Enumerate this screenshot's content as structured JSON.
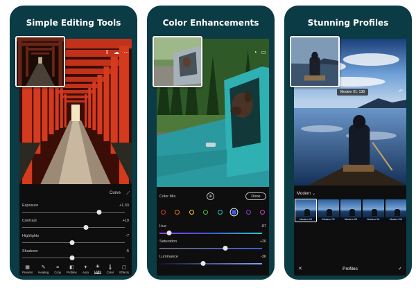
{
  "panels": [
    {
      "title": "Simple Editing Tools",
      "curve_label": "Curve",
      "sliders": [
        {
          "label": "Exposure",
          "value": "+1.33",
          "position": 0.72
        },
        {
          "label": "Contrast",
          "value": "+19",
          "position": 0.6
        },
        {
          "label": "Highlights",
          "value": "-7",
          "position": 0.47
        },
        {
          "label": "Shadows",
          "value": "-5",
          "position": 0.47
        }
      ],
      "toolbar": [
        {
          "label": "Presets",
          "icon": "presets-icon",
          "glyph": "▦"
        },
        {
          "label": "Healing",
          "icon": "healing-icon",
          "glyph": "✎"
        },
        {
          "label": "Crop",
          "icon": "crop-icon",
          "glyph": "⌗"
        },
        {
          "label": "Profiles",
          "icon": "profiles-icon",
          "glyph": "◧"
        },
        {
          "label": "Auto",
          "icon": "auto-icon",
          "glyph": "✦"
        },
        {
          "label": "Light",
          "icon": "light-icon",
          "glyph": "☀"
        },
        {
          "label": "Color",
          "icon": "color-icon",
          "glyph": "🌡"
        },
        {
          "label": "Effects",
          "icon": "effects-icon",
          "glyph": "▢"
        }
      ],
      "active_tool": "Light"
    },
    {
      "title": "Color Enhancements",
      "color_mix_label": "Color Mix",
      "done_label": "Done",
      "swatch_colors": [
        "#e0352b",
        "#f07a1e",
        "#f2d21a",
        "#48c23c",
        "#2ec9c9",
        "#3c5ae0",
        "#8a3ce0",
        "#d63cc9"
      ],
      "selected_swatch": 5,
      "sliders": [
        {
          "label": "Hue",
          "value": "-87",
          "position": 0.09,
          "gradient": "linear-gradient(90deg,#9a3cf0,#3c5ae0,#2ec9c9)"
        },
        {
          "label": "Saturation",
          "value": "+26",
          "position": 0.62,
          "gradient": "linear-gradient(90deg,#666666,#3c5ae0)"
        },
        {
          "label": "Luminance",
          "value": "-36",
          "position": 0.41,
          "gradient": "linear-gradient(90deg,#111133,#8aa0ff)"
        }
      ]
    },
    {
      "title": "Stunning Profiles",
      "profile_chip": "Modern 01: 138",
      "group_label": "Modern",
      "profiles": [
        "Modern 01",
        "Modern 02",
        "Modern 03",
        "Modern 04",
        "Modern 05"
      ],
      "selected_profile": 0,
      "bottom_label": "Profiles"
    }
  ]
}
